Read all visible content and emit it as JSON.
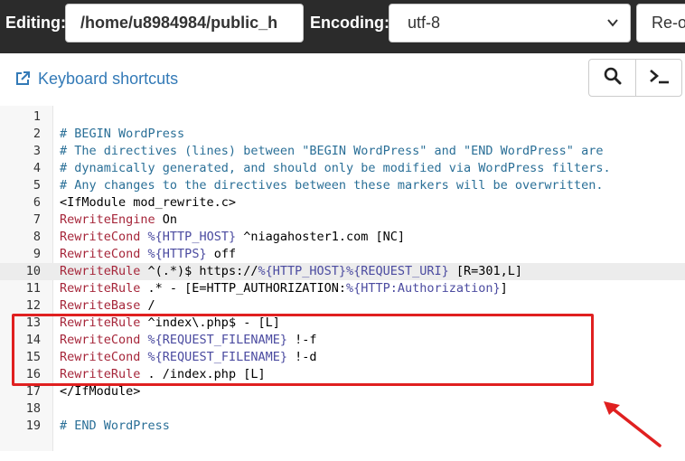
{
  "topbar": {
    "editing_label": "Editing:",
    "path_value": "/home/u8984984/public_h",
    "encoding_label": "Encoding:",
    "encoding_value": "utf-8",
    "reopen_label": "Re-o"
  },
  "toolbar": {
    "keyboard_shortcuts": "Keyboard shortcuts",
    "icons": [
      "external-link-icon",
      "search-icon",
      "terminal-icon"
    ]
  },
  "editor": {
    "lines": [
      {
        "num": "1",
        "segments": []
      },
      {
        "num": "2",
        "segments": [
          {
            "t": "# BEGIN WordPress",
            "c": "comment"
          }
        ]
      },
      {
        "num": "3",
        "segments": [
          {
            "t": "# The directives (lines) between \"BEGIN WordPress\" and \"END WordPress\" are",
            "c": "comment"
          }
        ]
      },
      {
        "num": "4",
        "segments": [
          {
            "t": "# dynamically generated, and should only be modified via WordPress filters.",
            "c": "comment"
          }
        ]
      },
      {
        "num": "5",
        "segments": [
          {
            "t": "# Any changes to the directives between these markers will be overwritten.",
            "c": "comment"
          }
        ]
      },
      {
        "num": "6",
        "segments": [
          {
            "t": "<IfModule mod_rewrite.c>",
            "c": "plain"
          }
        ]
      },
      {
        "num": "7",
        "segments": [
          {
            "t": "RewriteEngine",
            "c": "dir"
          },
          {
            "t": " On",
            "c": "plain"
          }
        ]
      },
      {
        "num": "8",
        "segments": [
          {
            "t": "RewriteCond",
            "c": "dir"
          },
          {
            "t": " ",
            "c": "plain"
          },
          {
            "t": "%{HTTP_HOST}",
            "c": "var"
          },
          {
            "t": " ^niagahoster1.com [NC]",
            "c": "plain"
          }
        ]
      },
      {
        "num": "9",
        "segments": [
          {
            "t": "RewriteCond",
            "c": "dir"
          },
          {
            "t": " ",
            "c": "plain"
          },
          {
            "t": "%{HTTPS}",
            "c": "var"
          },
          {
            "t": " off",
            "c": "plain"
          }
        ]
      },
      {
        "num": "10",
        "segments": [
          {
            "t": "RewriteRule",
            "c": "dir"
          },
          {
            "t": " ^(.*)$ https://",
            "c": "plain"
          },
          {
            "t": "%{HTTP_HOST}%{REQUEST_URI}",
            "c": "var"
          },
          {
            "t": " [R=301,L]",
            "c": "plain"
          }
        ],
        "active": true
      },
      {
        "num": "11",
        "segments": [
          {
            "t": "RewriteRule",
            "c": "dir"
          },
          {
            "t": " .* - [E=HTTP_AUTHORIZATION:",
            "c": "plain"
          },
          {
            "t": "%{HTTP:Authorization}",
            "c": "var"
          },
          {
            "t": "]",
            "c": "plain"
          }
        ]
      },
      {
        "num": "12",
        "segments": [
          {
            "t": "RewriteBase",
            "c": "dir"
          },
          {
            "t": " /",
            "c": "plain"
          }
        ]
      },
      {
        "num": "13",
        "segments": [
          {
            "t": "RewriteRule",
            "c": "dir"
          },
          {
            "t": " ^index\\.php$ - [L]",
            "c": "plain"
          }
        ]
      },
      {
        "num": "14",
        "segments": [
          {
            "t": "RewriteCond",
            "c": "dir"
          },
          {
            "t": " ",
            "c": "plain"
          },
          {
            "t": "%{REQUEST_FILENAME}",
            "c": "var"
          },
          {
            "t": " !-f",
            "c": "plain"
          }
        ]
      },
      {
        "num": "15",
        "segments": [
          {
            "t": "RewriteCond",
            "c": "dir"
          },
          {
            "t": " ",
            "c": "plain"
          },
          {
            "t": "%{REQUEST_FILENAME}",
            "c": "var"
          },
          {
            "t": " !-d",
            "c": "plain"
          }
        ]
      },
      {
        "num": "16",
        "segments": [
          {
            "t": "RewriteRule",
            "c": "dir"
          },
          {
            "t": " . /index.php [L]",
            "c": "plain"
          }
        ]
      },
      {
        "num": "17",
        "segments": [
          {
            "t": "</IfModule>",
            "c": "plain"
          }
        ]
      },
      {
        "num": "18",
        "segments": []
      },
      {
        "num": "19",
        "segments": [
          {
            "t": "# END WordPress",
            "c": "comment"
          }
        ]
      }
    ]
  },
  "annotation": {
    "highlight_color": "#e02020",
    "arrow_color": "#e02020"
  }
}
